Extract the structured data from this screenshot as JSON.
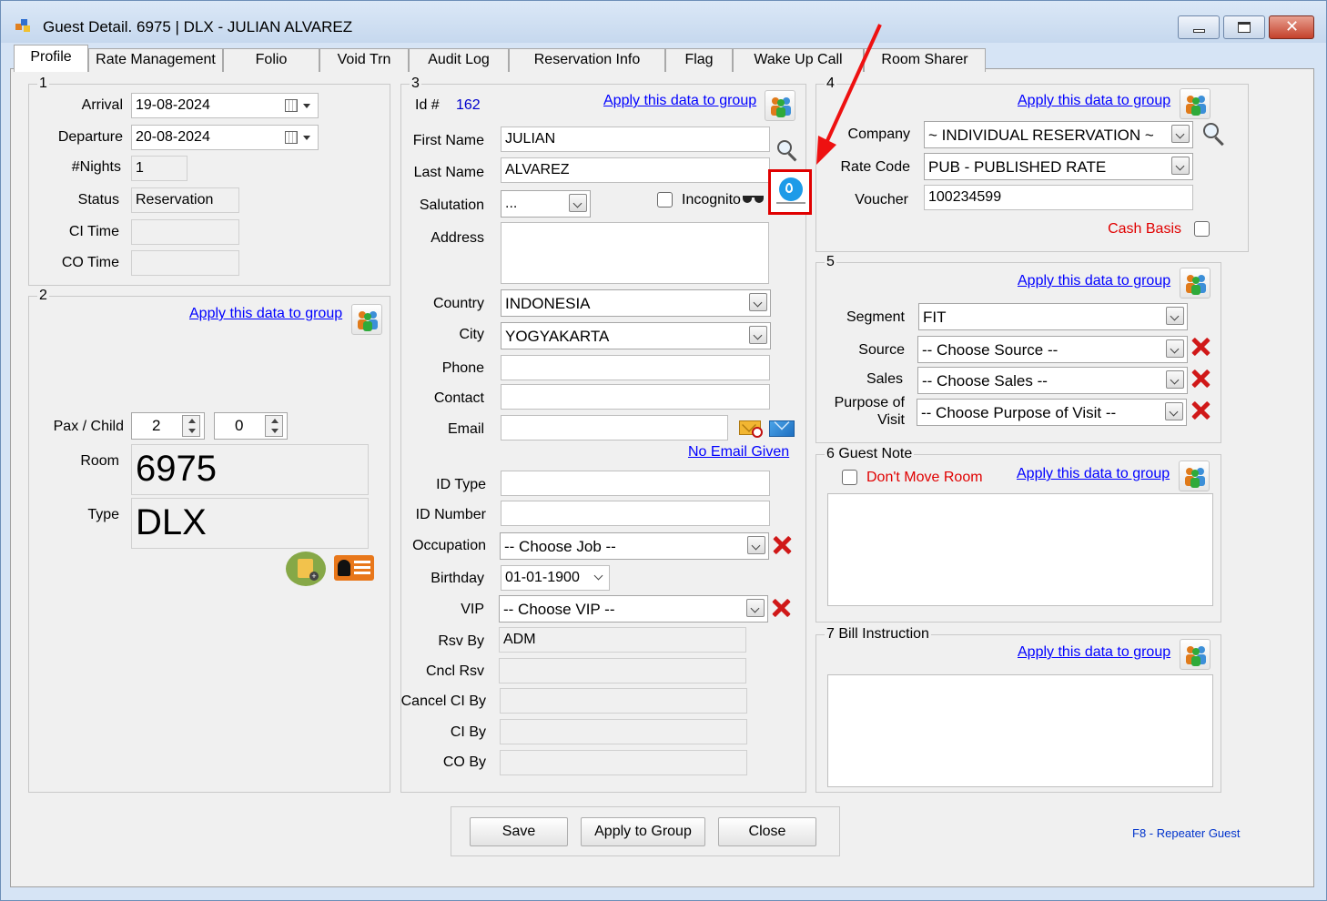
{
  "window": {
    "title": "Guest Detail. 6975 | DLX - JULIAN ALVAREZ",
    "minimize_icon": "minimize-icon",
    "maximize_icon": "maximize-icon",
    "close_icon": "close-icon"
  },
  "tabs": [
    "Profile",
    "Rate Management",
    "Folio",
    "Void Trn",
    "Audit Log",
    "Reservation Info",
    "Flag",
    "Wake Up Call",
    "Room Sharer"
  ],
  "section1": {
    "title": "1",
    "arrival_label": "Arrival",
    "arrival_value": "19-08-2024",
    "departure_label": "Departure",
    "departure_value": "20-08-2024",
    "nights_label": "#Nights",
    "nights_value": "1",
    "status_label": "Status",
    "status_value": "Reservation",
    "ci_time_label": "CI Time",
    "ci_time_value": "",
    "co_time_label": "CO Time",
    "co_time_value": ""
  },
  "section2": {
    "title": "2",
    "apply_group_link": "Apply this data to group",
    "pax_child_label": "Pax / Child",
    "pax_value": "2",
    "child_value": "0",
    "room_label": "Room",
    "room_value": "6975",
    "type_label": "Type",
    "type_value": "DLX"
  },
  "section3": {
    "title": "3",
    "id_label": "Id #",
    "id_value": "162",
    "apply_group_link": "Apply this data to group",
    "first_name_label": "First Name",
    "first_name_value": "JULIAN",
    "last_name_label": "Last Name",
    "last_name_value": "ALVAREZ",
    "salutation_label": "Salutation",
    "salutation_value": "...",
    "incognito_label": "Incognito",
    "address_label": "Address",
    "country_label": "Country",
    "country_value": "INDONESIA",
    "city_label": "City",
    "city_value": "YOGYAKARTA",
    "phone_label": "Phone",
    "contact_label": "Contact",
    "email_label": "Email",
    "no_email_link": "No Email Given",
    "id_type_label": "ID Type",
    "id_number_label": "ID Number",
    "occupation_label": "Occupation",
    "occupation_value": "-- Choose Job --",
    "birthday_label": "Birthday",
    "birthday_value": "01-01-1900",
    "vip_label": "VIP",
    "vip_value": "-- Choose VIP --",
    "rsv_by_label": "Rsv By",
    "rsv_by_value": "ADM",
    "cncl_rsv_label": "Cncl Rsv",
    "cancel_ci_by_label": "Cancel CI By",
    "ci_by_label": "CI By",
    "co_by_label": "CO By"
  },
  "section4": {
    "title": "4",
    "apply_group_link": "Apply this data to group",
    "company_label": "Company",
    "company_value": "~ INDIVIDUAL RESERVATION ~",
    "rate_code_label": "Rate Code",
    "rate_code_value": "PUB - PUBLISHED RATE",
    "voucher_label": "Voucher",
    "voucher_value": "100234599",
    "cash_basis_label": "Cash Basis"
  },
  "section5": {
    "title": "5",
    "apply_group_link": "Apply this data to group",
    "segment_label": "Segment",
    "segment_value": "FIT",
    "source_label": "Source",
    "source_value": "-- Choose Source --",
    "sales_label": "Sales",
    "sales_value": "-- Choose Sales --",
    "purpose_label_1": "Purpose of",
    "purpose_label_2": "Visit",
    "purpose_value": "-- Choose Purpose of Visit --"
  },
  "section6": {
    "title": "6 Guest Note",
    "dont_move_label": "Don't Move Room",
    "apply_group_link": "Apply this data to group"
  },
  "section7": {
    "title": "7 Bill Instruction",
    "apply_group_link": "Apply this data to group"
  },
  "buttons": {
    "save": "Save",
    "apply_group": "Apply to Group",
    "close": "Close"
  },
  "footer": {
    "f8_hint": "F8 - Repeater Guest"
  },
  "colors": {
    "link": "#0000ff",
    "id_value": "#0000cc",
    "warning_text": "#e00000",
    "highlight_box": "#e00000",
    "annotation_arrow": "#ee1111",
    "f8_hint": "#0033cc"
  }
}
